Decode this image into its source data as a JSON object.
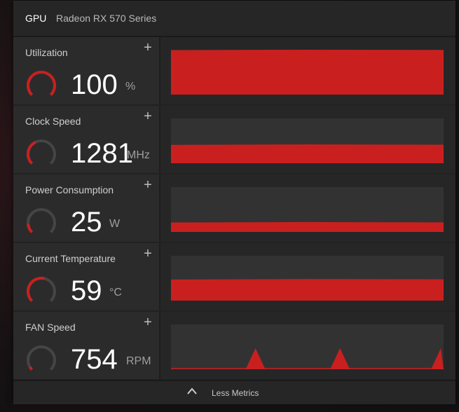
{
  "header": {
    "gpu_label": "GPU",
    "model": "Radeon RX 570 Series"
  },
  "colors": {
    "accent": "#c9201f",
    "gauge_track": "#454546",
    "graph_bg": "#323233"
  },
  "metrics": [
    {
      "label": "Utilization",
      "value": "100",
      "unit": "%",
      "gauge_fraction": 1.0,
      "graph_level": 1.0,
      "graph_type": "fill"
    },
    {
      "label": "Clock Speed",
      "value": "1281",
      "unit": "MHz",
      "gauge_fraction": 0.4,
      "graph_level": 0.42,
      "graph_type": "fill"
    },
    {
      "label": "Power Consumption",
      "value": "25",
      "unit": "W",
      "gauge_fraction": 0.15,
      "graph_level": 0.22,
      "graph_type": "fill"
    },
    {
      "label": "Current Temperature",
      "value": "59",
      "unit": "°C",
      "gauge_fraction": 0.55,
      "graph_level": 0.48,
      "graph_type": "fill"
    },
    {
      "label": "FAN Speed",
      "value": "754",
      "unit": "RPM",
      "gauge_fraction": 0.05,
      "graph_level": 0.0,
      "graph_type": "spikes",
      "spikes": [
        0.31,
        0.62,
        0.99
      ]
    }
  ],
  "icons": {
    "add": "plus-icon",
    "collapse": "chevron-up-icon"
  },
  "plus_glyph": "+",
  "footer": {
    "label": "Less Metrics"
  }
}
